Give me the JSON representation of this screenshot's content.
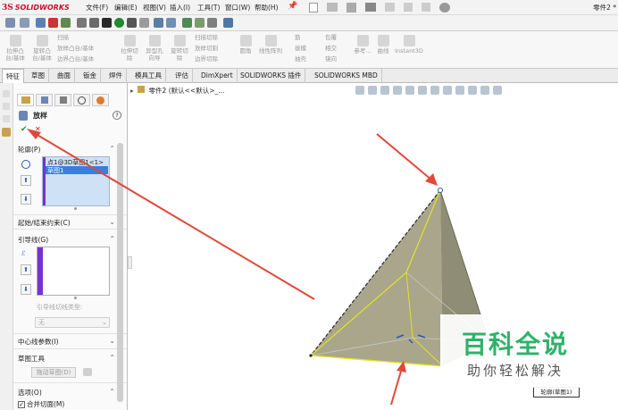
{
  "app": {
    "brand_ds": "3S",
    "brand_name": "SOLIDWORKS",
    "doc_title": "零件2 *"
  },
  "menu": [
    "文件(F)",
    "编辑(E)",
    "视图(V)",
    "插入(I)",
    "工具(T)",
    "窗口(W)",
    "帮助(H)"
  ],
  "ribbon": {
    "items": [
      {
        "label": "拉伸凸\n台/基体"
      },
      {
        "label": "旋转凸\n台/基体"
      },
      {
        "label": "扫描"
      },
      {
        "label": "放样凸台/基体"
      },
      {
        "label": "边界凸台/基体"
      },
      {
        "label": "拉伸切\n除"
      },
      {
        "label": "异型孔\n向导"
      },
      {
        "label": "旋转切\n除"
      },
      {
        "label": "扫描切除"
      },
      {
        "label": "放样切割"
      },
      {
        "label": "边界切除"
      },
      {
        "label": "圆角"
      },
      {
        "label": "线性阵列"
      },
      {
        "label": "筋"
      },
      {
        "label": "拔模"
      },
      {
        "label": "抽壳"
      },
      {
        "label": "包覆"
      },
      {
        "label": "相交"
      },
      {
        "label": "镜向"
      },
      {
        "label": "参考..."
      },
      {
        "label": "曲线"
      },
      {
        "label": "Instant3D"
      }
    ]
  },
  "tabs": [
    "特征",
    "草图",
    "曲面",
    "钣金",
    "焊件",
    "模具工具",
    "评估",
    "DimXpert",
    "SOLIDWORKS 插件",
    "SOLIDWORKS MBD"
  ],
  "active_tab": "特征",
  "panel": {
    "title": "放样",
    "help": "?",
    "ok": "✔",
    "cancel": "✕",
    "profiles": {
      "header": "轮廓(P)",
      "items": [
        "点1@3D草图1<1>",
        "草图1"
      ]
    },
    "start_end": {
      "header": "起始/结束约束(C)"
    },
    "guides": {
      "header": "引导线(G)",
      "tangency_label": "引导线切线类型:",
      "tangency_value": "无"
    },
    "centerline": {
      "header": "中心线参数(I)"
    },
    "sketch_tools": {
      "header": "草图工具",
      "drag_button": "拖动草图(D)"
    },
    "options": {
      "header": "选项(O)",
      "merge": "合并切面(M)"
    }
  },
  "tree": {
    "root": "零件2 (默认<<默认>_..."
  },
  "viewport": {
    "sketch_label": "轮廓(草图1)"
  },
  "watermark": {
    "line1": "百科全说",
    "line2": "助你轻松解决"
  },
  "colors": {
    "accent_red": "#e0493a",
    "face_olive": "#a6a38a",
    "edge_yellow": "#e3e324",
    "watermark_green": "#2fb26a"
  },
  "icons": [
    "loft-icon",
    "check-icon",
    "close-icon",
    "help-icon",
    "up-arrow-icon",
    "down-arrow-icon"
  ]
}
